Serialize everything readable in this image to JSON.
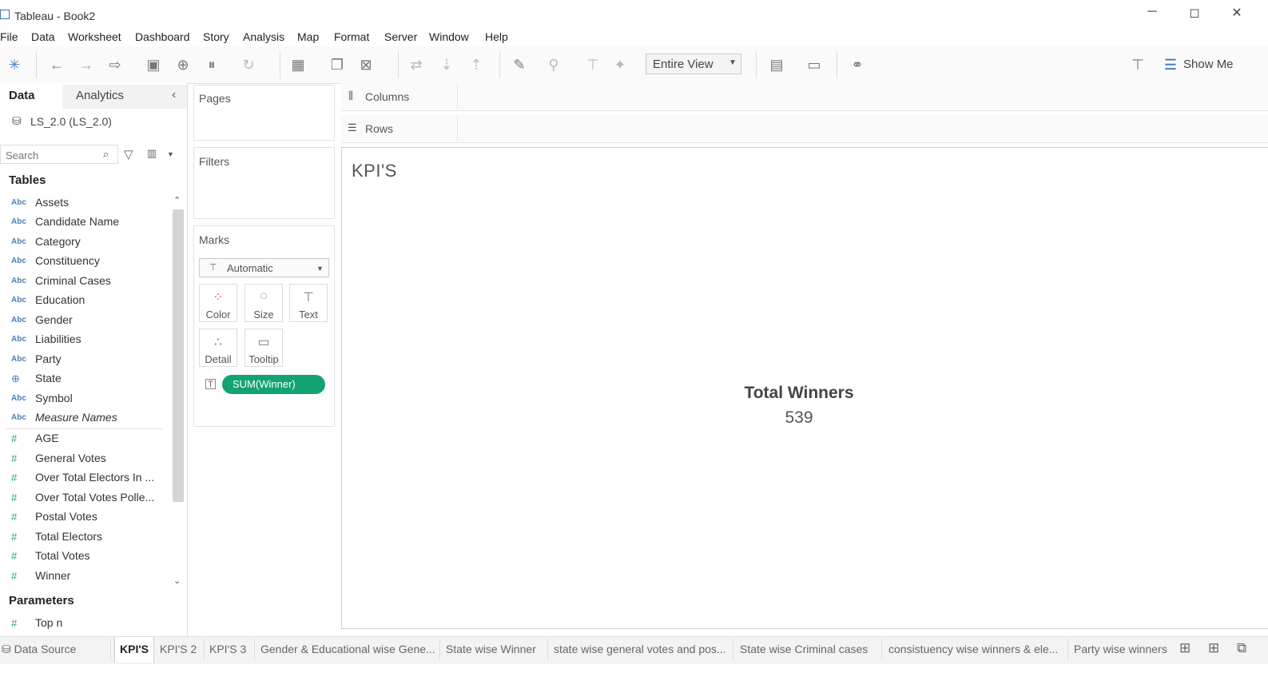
{
  "window": {
    "title": "Tableau - Book2",
    "minimize": "─",
    "restore": "◻",
    "close": "✕"
  },
  "menu": [
    "File",
    "Data",
    "Worksheet",
    "Dashboard",
    "Story",
    "Analysis",
    "Map",
    "Format",
    "Server",
    "Window",
    "Help"
  ],
  "toolbar": {
    "fit_value": "Entire View",
    "show_me_label": "Show Me"
  },
  "data_pane": {
    "tabs": {
      "data": "Data",
      "analytics": "Analytics"
    },
    "datasource": "LS_2.0 (LS_2.0)",
    "search_placeholder": "Search",
    "tables_heading": "Tables",
    "dimensions": [
      {
        "type": "Abc",
        "name": "Assets"
      },
      {
        "type": "Abc",
        "name": "Candidate Name"
      },
      {
        "type": "Abc",
        "name": "Category"
      },
      {
        "type": "Abc",
        "name": "Constituency"
      },
      {
        "type": "Abc",
        "name": "Criminal Cases"
      },
      {
        "type": "Abc",
        "name": "Education"
      },
      {
        "type": "Abc",
        "name": "Gender"
      },
      {
        "type": "Abc",
        "name": "Liabilities"
      },
      {
        "type": "Abc",
        "name": "Party"
      },
      {
        "type": "geo",
        "name": "State"
      },
      {
        "type": "Abc",
        "name": "Symbol"
      },
      {
        "type": "Abc",
        "name": "Measure Names"
      }
    ],
    "measures": [
      {
        "type": "#",
        "name": "AGE"
      },
      {
        "type": "#",
        "name": "General Votes"
      },
      {
        "type": "#",
        "name": "Over Total Electors In ..."
      },
      {
        "type": "#",
        "name": "Over Total Votes Polle..."
      },
      {
        "type": "#",
        "name": "Postal Votes"
      },
      {
        "type": "#",
        "name": "Total Electors"
      },
      {
        "type": "#",
        "name": "Total Votes"
      },
      {
        "type": "#",
        "name": "Winner"
      }
    ],
    "parameters_heading": "Parameters",
    "parameters": [
      {
        "type": "#",
        "name": "Top n"
      }
    ]
  },
  "cards": {
    "pages": "Pages",
    "filters": "Filters",
    "marks": "Marks",
    "mark_type": "Automatic",
    "mark_buttons": {
      "color": "Color",
      "size": "Size",
      "text": "Text",
      "detail": "Detail",
      "tooltip": "Tooltip"
    },
    "pill": "SUM(Winner)"
  },
  "shelves": {
    "columns": "Columns",
    "rows": "Rows"
  },
  "view": {
    "title": "KPI'S",
    "kpi_label": "Total Winners",
    "kpi_value": "539"
  },
  "sheet_tabs": {
    "data_source": "Data Source",
    "tabs": [
      "KPI'S",
      "KPI'S 2",
      "KPI'S 3",
      "Gender & Educational wise Gene...",
      "State wise Winner",
      "state wise general votes and pos...",
      "State wise Criminal cases",
      "consistuency wise winners & ele...",
      "Party wise winners"
    ],
    "active": 0
  },
  "icons": {
    "accent_green": "#13a372",
    "dimension_blue": "#4a7ebb",
    "measure_green": "#1fa67a"
  }
}
